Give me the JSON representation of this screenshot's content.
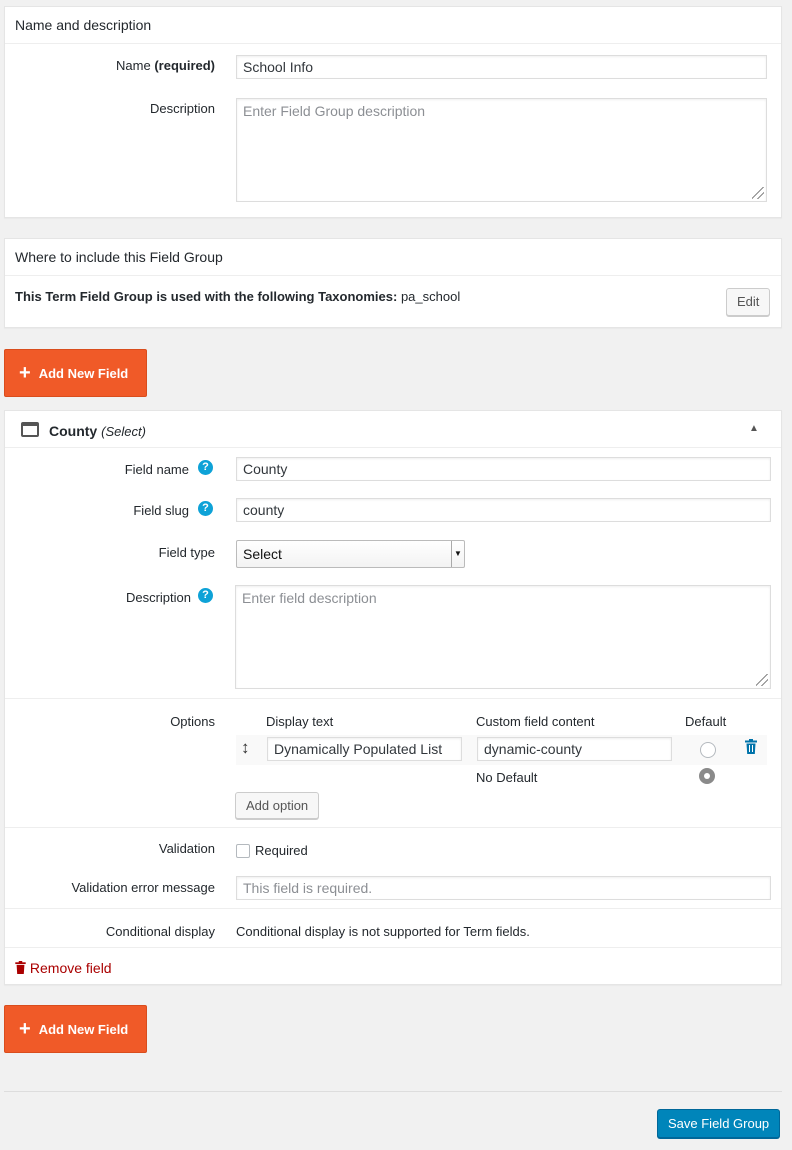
{
  "name_panel": {
    "title": "Name and description",
    "name_label": "Name",
    "name_required": "(required)",
    "name_value": "School Info",
    "description_label": "Description",
    "description_placeholder": "Enter Field Group description"
  },
  "include_panel": {
    "title": "Where to include this Field Group",
    "info_bold": "This Term Field Group is used with the following Taxonomies:",
    "info_value": "pa_school",
    "edit_label": "Edit"
  },
  "add_new_field_label": "Add New Field",
  "field": {
    "title": "County",
    "type_note": "(Select)",
    "field_name_label": "Field name",
    "field_name_value": "County",
    "field_slug_label": "Field slug",
    "field_slug_value": "county",
    "field_type_label": "Field type",
    "field_type_value": "Select",
    "description_label": "Description",
    "description_placeholder": "Enter field description",
    "options_label": "Options",
    "col_display": "Display text",
    "col_custom": "Custom field content",
    "col_default": "Default",
    "option_display_value": "Dynamically Populated List",
    "option_custom_value": "dynamic-county",
    "no_default": "No Default",
    "add_option_label": "Add option",
    "validation_label": "Validation",
    "required_label": "Required",
    "validation_error_label": "Validation error message",
    "validation_error_placeholder": "This field is required.",
    "conditional_label": "Conditional display",
    "conditional_text": "Conditional display is not supported for Term fields.",
    "remove_label": "Remove field",
    "help_glyph": "?"
  },
  "save_label": "Save Field Group",
  "colors": {
    "accent_orange": "#f05a28",
    "primary_blue": "#0073aa",
    "remove_red": "#a00"
  }
}
